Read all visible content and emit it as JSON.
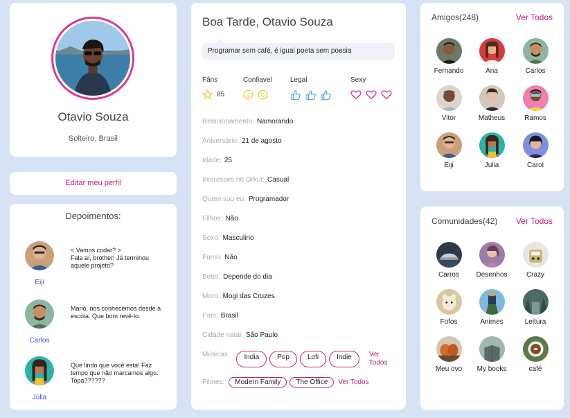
{
  "profile": {
    "name": "Otavio Souza",
    "subtitle": "Solteiro, Brasil",
    "edit_label": "Editar meu perfil"
  },
  "testimonials": {
    "title": "Depoimentos:",
    "items": [
      {
        "name": "Eiji",
        "text": "< Vamos codar? >\nFala aí, brother! Já terminou aquele projeto?"
      },
      {
        "name": "Carlos",
        "text": "Mano, nos conhecemos desde a escola. Que bom revê-lo."
      },
      {
        "name": "Júlia",
        "text": "Que lindo que você está! Faz tempo que não marcamos algo. Topa??????"
      }
    ]
  },
  "main": {
    "greeting": "Boa Tarde, Otavio Souza",
    "status": "Programar sem café, é igual poeta sem poesia",
    "ratings": {
      "fans_label": "Fãns",
      "fans_count": "85",
      "trusty_label": "Confiavel",
      "cool_label": "Legal",
      "sexy_label": "Sexy"
    },
    "info": [
      {
        "label": "Relacionamento:",
        "value": "Namorando"
      },
      {
        "label": "Aniversário:",
        "value": "21 de agosto"
      },
      {
        "label": "Idade:",
        "value": "25"
      },
      {
        "label": "Interesses no Orkut:",
        "value": "Casual"
      },
      {
        "label": "Quem sou eu:",
        "value": "Programador"
      },
      {
        "label": "Filhos:",
        "value": "Não"
      },
      {
        "label": "Sexo:",
        "value": "Masculino"
      },
      {
        "label": "Fumo:",
        "value": "Não"
      },
      {
        "label": "Bebo:",
        "value": "Depende do dia"
      },
      {
        "label": "Moro:",
        "value": "Mogi das Cruzes"
      },
      {
        "label": "País:",
        "value": "Brasil"
      },
      {
        "label": "Cidade natal:",
        "value": "São Paulo"
      }
    ],
    "music_label": "Músicas:",
    "music": [
      "India",
      "Pop",
      "Lofi",
      "Indie"
    ],
    "music_more_1": "Ver",
    "music_more_2": "Todos",
    "films_label": "Filmes:",
    "films": [
      "Modern Family",
      "The Office"
    ],
    "films_more": "Ver Todos"
  },
  "friends": {
    "title": "Amigos(248)",
    "see_all": "Ver Todos",
    "items": [
      "Fernando",
      "Ana",
      "Carlos",
      "Vitor",
      "Matheus",
      "Ramos",
      "Eiji",
      "Julia",
      "Carol"
    ]
  },
  "communities": {
    "title": "Comunidades(42)",
    "see_all": "Ver Todos",
    "items": [
      "Carros",
      "Desenhos",
      "Crazy",
      "Fofos",
      "Animes",
      "Leitura",
      "Meu ovo",
      "My books",
      "café"
    ]
  },
  "colors": {
    "accent": "#c2227a",
    "link_blue": "#3a4bd6",
    "background": "#d6e3f5"
  }
}
